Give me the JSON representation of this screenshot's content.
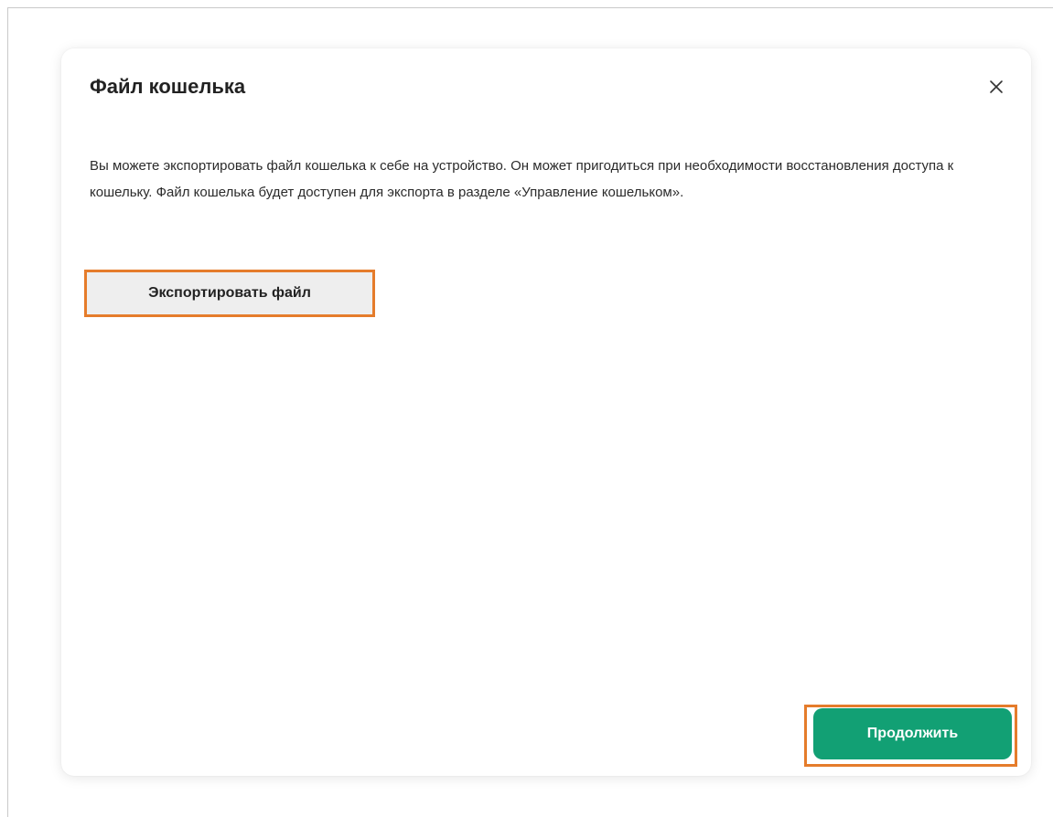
{
  "dialog": {
    "title": "Файл кошелька",
    "description": "Вы можете экспортировать файл кошелька к себе на устройство. Он может пригодиться при необходимости восстановления доступа к кошельку. Файл кошелька будет доступен для экспорта в разделе «Управление кошельком».",
    "export_button_label": "Экспортировать файл",
    "continue_button_label": "Продолжить",
    "close_icon": "close-icon"
  },
  "colors": {
    "primary_button": "#12a074",
    "secondary_button": "#eeeeee",
    "highlight_border": "#e57c2b",
    "text": "#222222"
  }
}
